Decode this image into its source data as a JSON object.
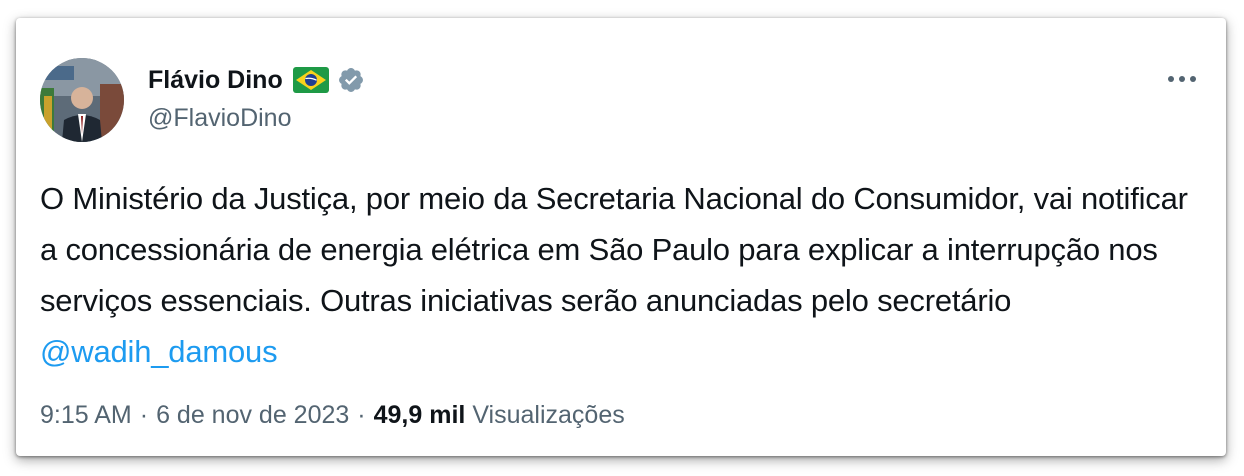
{
  "author": {
    "name": "Flávio Dino",
    "handle": "@FlavioDino",
    "flag_icon": "brazil-flag-icon",
    "verified_icon": "verified-badge-icon"
  },
  "tweet": {
    "text_main": "O Ministério da Justiça, por meio da Secretaria Nacional do Consumidor, vai notificar a concessionária de energia elétrica em São Paulo para explicar a interrupção nos serviços essenciais. Outras iniciativas serão anunciadas pelo secretário ",
    "mention": "@wadih_damous"
  },
  "meta": {
    "time": "9:15 AM",
    "separator": "·",
    "date": "6 de nov de 2023",
    "views_count": "49,9 mil",
    "views_label": "Visualizações"
  },
  "colors": {
    "text_primary": "#0f1419",
    "text_secondary": "#536471",
    "link": "#1d9bf0",
    "verified": "#829aab"
  }
}
